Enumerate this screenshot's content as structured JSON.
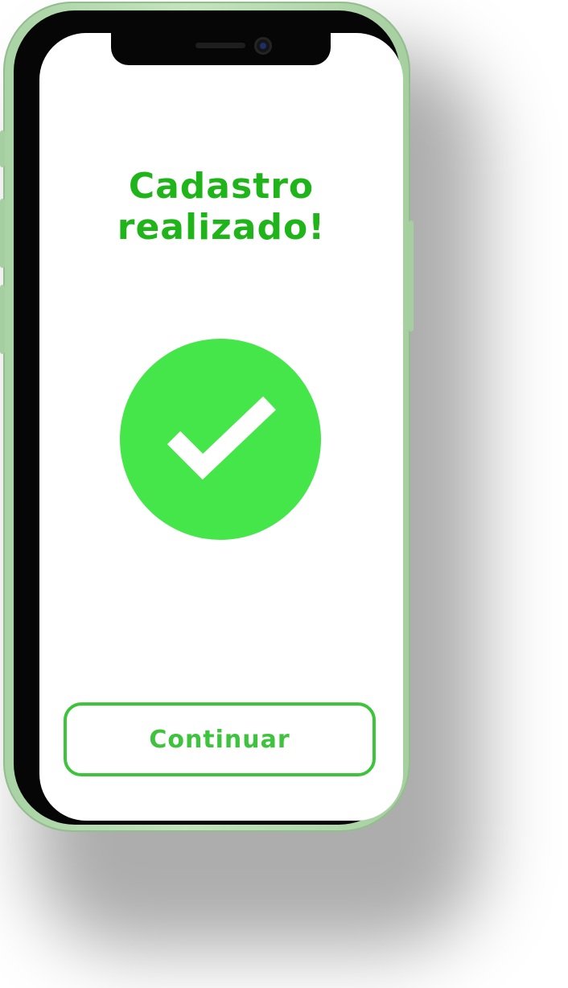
{
  "device": {
    "frame_color": "#b7dcb1",
    "bezel_color": "#060606",
    "notch_icons": [
      "speaker-grille",
      "front-camera"
    ]
  },
  "screen": {
    "background": "#ffffff",
    "title_lines": [
      "Cadastro",
      "realizado!"
    ],
    "title_color": "#1fb51a",
    "success_icon": "checkmark-circle-icon",
    "success_color": "#44e649",
    "continue_button": {
      "label": "Continuar",
      "color": "#3ec43c"
    }
  }
}
